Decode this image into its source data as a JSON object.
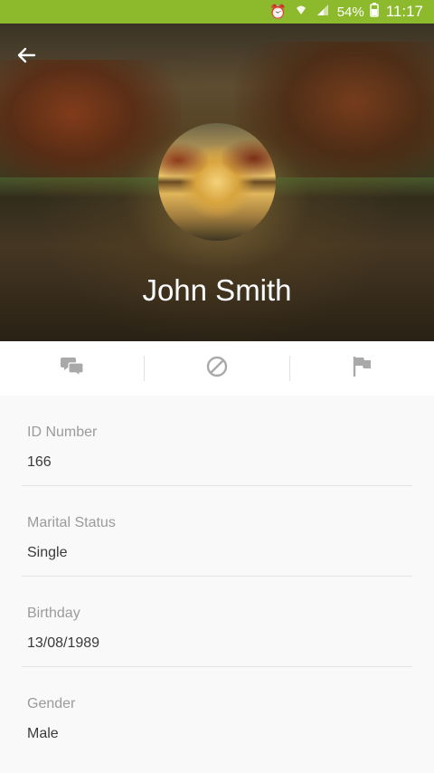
{
  "status_bar": {
    "battery": "54%",
    "time": "11:17"
  },
  "header": {
    "name": "John Smith"
  },
  "fields": [
    {
      "label": "ID Number",
      "value": "166"
    },
    {
      "label": "Marital Status",
      "value": "Single"
    },
    {
      "label": "Birthday",
      "value": "13/08/1989"
    },
    {
      "label": "Gender",
      "value": "Male"
    }
  ],
  "icons": {
    "back": "arrow-left-icon",
    "chat": "chat-bubbles-icon",
    "block": "block-icon",
    "report": "flag-icon"
  },
  "colors": {
    "status_bar": "#8cba2c",
    "label": "#9b9b9b",
    "value": "#3a3a3a",
    "icon": "#a9a9a9"
  }
}
